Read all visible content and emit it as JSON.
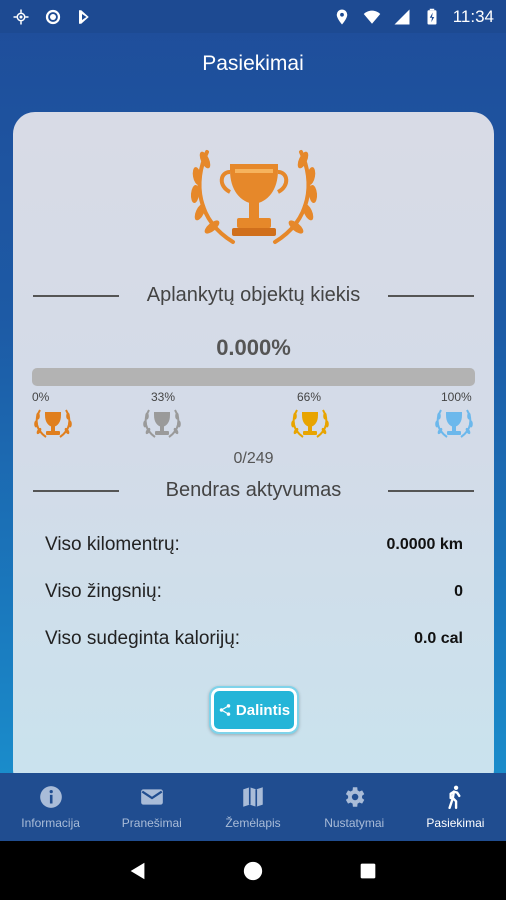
{
  "status_bar": {
    "time": "11:34",
    "icons_left": [
      "location-crosshair-icon",
      "circle-app-icon",
      "flag-app-icon"
    ],
    "icons_right": [
      "location-pin-icon",
      "wifi-icon",
      "signal-icon",
      "battery-charging-icon"
    ]
  },
  "app_bar": {
    "title": "Pasiekimai"
  },
  "visited": {
    "section_title": "Aplankytų objektų kiekis",
    "percent_text": "0.000%",
    "progress_fraction": 0.0,
    "milestones": [
      {
        "label": "0%",
        "color": "#e07f1e"
      },
      {
        "label": "33%",
        "color": "#9a9a9a"
      },
      {
        "label": "66%",
        "color": "#e8a400"
      },
      {
        "label": "100%",
        "color": "#6cb8ec"
      }
    ],
    "count_text": "0/249"
  },
  "activity": {
    "section_title": "Bendras aktyvumas",
    "rows": [
      {
        "label": "Viso kilomentrų:",
        "value": "0.0000 km"
      },
      {
        "label": "Viso žingsnių:",
        "value": "0"
      },
      {
        "label": "Viso sudeginta kalorijų:",
        "value": "0.0 cal"
      }
    ]
  },
  "share_button": {
    "label": "Dalintis",
    "icon": "share-icon"
  },
  "bottom_nav": {
    "items": [
      {
        "label": "Informacija",
        "icon": "info-icon"
      },
      {
        "label": "Pranešimai",
        "icon": "mail-icon"
      },
      {
        "label": "Žemėlapis",
        "icon": "map-icon"
      },
      {
        "label": "Nustatymai",
        "icon": "gear-icon"
      },
      {
        "label": "Pasiekimai",
        "icon": "walking-icon",
        "active": true
      }
    ]
  },
  "colors": {
    "accent": "#24b5d8",
    "bar_bg": "#204d90",
    "trophy_gold": "#e07f1e"
  }
}
